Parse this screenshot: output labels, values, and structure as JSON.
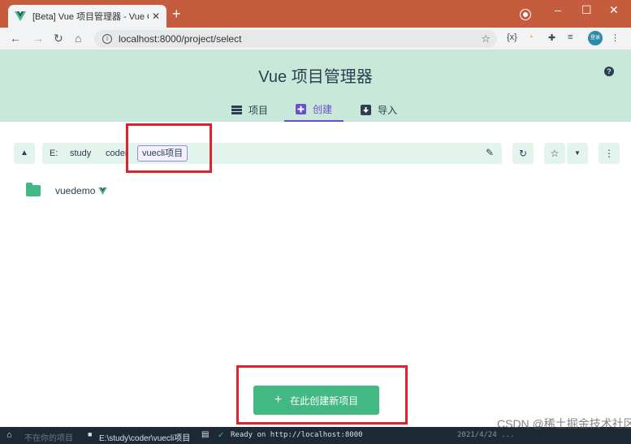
{
  "browser": {
    "tab_title": "[Beta] Vue 项目管理器 - Vue CLI",
    "tab_close": "✕",
    "new_tab": "+",
    "window_controls": [
      "–",
      "☐",
      "✕"
    ],
    "url": "localhost:8000/project/select",
    "avatar_text": "登录"
  },
  "app": {
    "title": "Vue 项目管理器",
    "help": "?",
    "nav": [
      {
        "label": "项目",
        "icon": "list-icon",
        "active": false
      },
      {
        "label": "创建",
        "icon": "plus-box-icon",
        "active": true
      },
      {
        "label": "导入",
        "icon": "import-icon",
        "active": false
      }
    ]
  },
  "path": {
    "segments": [
      "E:",
      "study",
      "coder",
      "vuecli项目"
    ],
    "current": "vuecli项目"
  },
  "folders": [
    {
      "name": "vuedemo",
      "is_vue_project": true
    }
  ],
  "create_button": {
    "label": "在此创建新项目",
    "icon": "plus-icon"
  },
  "statusbar": {
    "home_label": "不在你的项目",
    "path": "E:\\study\\coder\\vuecli项目",
    "ready": "Ready on http://localhost:8000",
    "datetime": "2021/4/24 ..."
  },
  "watermark": "CSDN @稀土掘金技术社区",
  "colors": {
    "accent": "#42b983",
    "header_bg": "#c8e9d9",
    "active_tab": "#6a4fc9",
    "title_bar": "#c45c3d",
    "highlight_box": "#e0232a"
  }
}
